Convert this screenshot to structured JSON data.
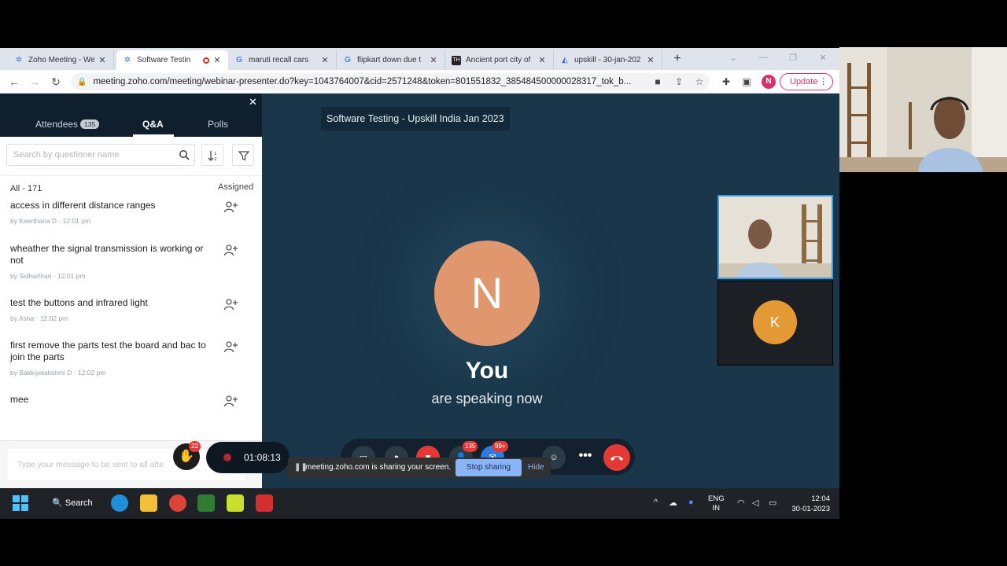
{
  "browser": {
    "tabs": [
      {
        "title": "Zoho Meeting - We",
        "favicon": "zoho-icon",
        "active": false
      },
      {
        "title": "Software Testin",
        "favicon": "zoho-icon",
        "active": true,
        "recording": true
      },
      {
        "title": "maruti recall cars",
        "favicon": "google-icon",
        "active": false
      },
      {
        "title": "flipkart down due t",
        "favicon": "google-icon",
        "active": false
      },
      {
        "title": "Ancient port city of",
        "favicon": "news-icon",
        "active": false
      },
      {
        "title": "upskill - 30-jan-202",
        "favicon": "chart-icon",
        "active": false
      }
    ],
    "url": "meeting.zoho.com/meeting/webinar-presenter.do?key=1043764007&cid=2571248&token=801551832_385484500000028317_tok_b...",
    "profile_initial": "N",
    "update_label": "Update",
    "colors": {
      "accent": "#d6336c",
      "tabstrip": "#dfe3eb"
    }
  },
  "panel": {
    "tabs": [
      {
        "label": "Attendees",
        "badge": "135"
      },
      {
        "label": "Q&A",
        "active": true
      },
      {
        "label": "Polls"
      }
    ],
    "search_placeholder": "Search by questioner name",
    "count_label": "All - 171",
    "assigned_label": "Assigned",
    "questions": [
      {
        "text": "access in different distance ranges",
        "by": "by Keerthana D",
        "time": "12:01 pm"
      },
      {
        "text": "wheather the signal transmission is working or not",
        "by": "by Sidharthan",
        "time": "12:01 pm"
      },
      {
        "text": "test the buttons and infrared light",
        "by": "by Asha",
        "time": "12:02 pm"
      },
      {
        "text": "first remove the parts test the board and bac to join the parts",
        "by": "by Bakkiyalakshmi D",
        "time": "12:02 pm"
      },
      {
        "text": "mee",
        "by": "",
        "time": ""
      }
    ],
    "message_placeholder": "Type your message to be sent to all atte"
  },
  "stage": {
    "session_title": "Software Testing - Upskill India Jan 2023",
    "avatar_initial": "N",
    "you_label": "You",
    "speaking_label": "are speaking now",
    "tile2_initial": "K",
    "colors": {
      "stage_bg": "#19364a",
      "avatar_n": "#e0976e",
      "avatar_k": "#e39a35"
    }
  },
  "controls": {
    "timer": "01:08:13",
    "hand_count": "22",
    "attendee_count": "135",
    "chat_count": "99+"
  },
  "share_notice": {
    "message": "meeting.zoho.com is sharing your screen.",
    "stop_label": "Stop sharing",
    "hide_label": "Hide"
  },
  "taskbar": {
    "search_label": "Search",
    "lang_line1": "ENG",
    "lang_line2": "IN",
    "time": "12:04",
    "date": "30-01-2023"
  }
}
